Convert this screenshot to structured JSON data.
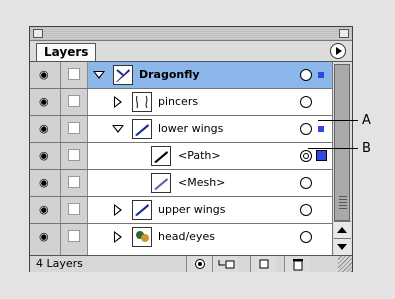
{
  "panel": {
    "tab_label": "Layers",
    "layer_count": "4 Layers"
  },
  "layers": [
    {
      "name": "Dragonfly",
      "selected": true,
      "expanded": true,
      "target": "single",
      "selection_square": "small",
      "highlight_color": "#8bb7ea"
    },
    {
      "name": "pincers",
      "expanded": false,
      "target": "single"
    },
    {
      "name": "lower wings",
      "expanded": true,
      "target": "single",
      "selection_square": "small"
    },
    {
      "name": "<Path>",
      "target": "double",
      "selection_square": "large"
    },
    {
      "name": "<Mesh>",
      "target": "single"
    },
    {
      "name": "upper wings",
      "expanded": false,
      "target": "single"
    },
    {
      "name": "head/eyes",
      "expanded": false,
      "target": "single"
    }
  ],
  "bottom_buttons": [
    "make-clipping-mask",
    "create-new-sublayer",
    "create-new-layer",
    "delete-layer"
  ],
  "callouts": [
    {
      "label": "A"
    },
    {
      "label": "B"
    }
  ],
  "colors": {
    "selection_blue": "#3246e0",
    "row_highlight": "#8bb7ea"
  }
}
